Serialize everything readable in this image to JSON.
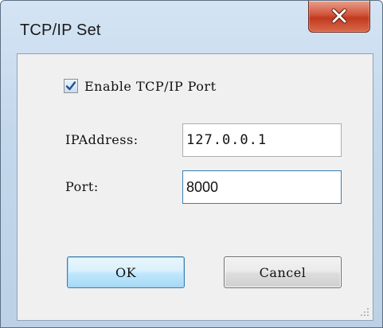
{
  "window": {
    "title": "TCP/IP Set"
  },
  "close_button": {
    "icon": "close-icon"
  },
  "enable_checkbox": {
    "checked": true,
    "label": "Enable TCP/IP Port"
  },
  "ip_field": {
    "label": "IPAddress:",
    "value": "127.0.0.1"
  },
  "port_field": {
    "label": "Port:",
    "value": "8000"
  },
  "buttons": {
    "ok_label": "OK",
    "cancel_label": "Cancel"
  },
  "colors": {
    "close_button": "#c8452c",
    "focus_border": "#3c7fb1"
  }
}
